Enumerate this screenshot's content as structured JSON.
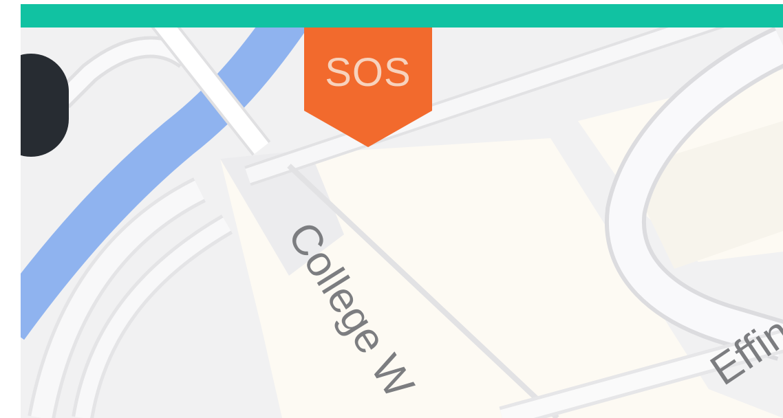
{
  "colors": {
    "top_bar": "#11c2a2",
    "water": "#8fb3ef",
    "land": "#f1f1f2",
    "building": "#fdfaf3",
    "road": "#ffffff",
    "road_outline": "#d9d9dc",
    "sos_marker": "#f26a2d",
    "sos_text": "#f7d2bd",
    "avatar": "#272c32",
    "label_text": "#7c7d80"
  },
  "sos_marker": {
    "label": "SOS",
    "icon": "sos-pin-icon"
  },
  "map": {
    "roads": [
      {
        "name": "College W"
      },
      {
        "name": "Effin"
      }
    ]
  }
}
